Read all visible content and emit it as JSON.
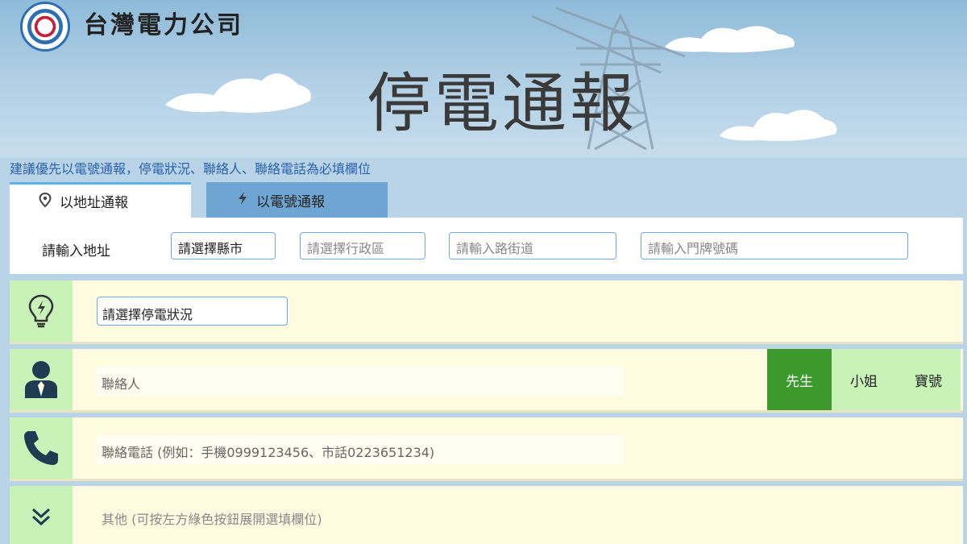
{
  "header": {
    "company": "台灣電力公司",
    "title": "停電通報"
  },
  "hint": "建議優先以電號通報，停電狀況、聯絡人、聯絡電話為必填欄位",
  "tabs": [
    {
      "label": "以地址通報",
      "icon": "location-pin-icon"
    },
    {
      "label": "以電號通報",
      "icon": "lightning-icon"
    }
  ],
  "address": {
    "label": "請輸入地址",
    "county": "請選擇縣市",
    "district": "請選擇行政區",
    "street": "請輸入路街道",
    "number": "請輸入門牌號碼"
  },
  "outage": {
    "icon": "lightbulb-icon",
    "select": "請選擇停電狀況"
  },
  "contact": {
    "icon": "person-icon",
    "placeholder": "聯絡人",
    "titles": [
      "先生",
      "小姐",
      "寶號"
    ],
    "selected": "先生"
  },
  "phone": {
    "icon": "phone-icon",
    "placeholder": "聯絡電話 (例如：手機0999123456、市話0223651234)"
  },
  "other": {
    "icon": "double-chevron-down-icon",
    "label": "其他 (可按左方綠色按鈕展開選填欄位)"
  },
  "colors": {
    "accent_blue": "#2962b0",
    "green_selected": "#3c9a2c",
    "green_light": "#c8f2b8",
    "row_bg": "#fffbe1"
  }
}
